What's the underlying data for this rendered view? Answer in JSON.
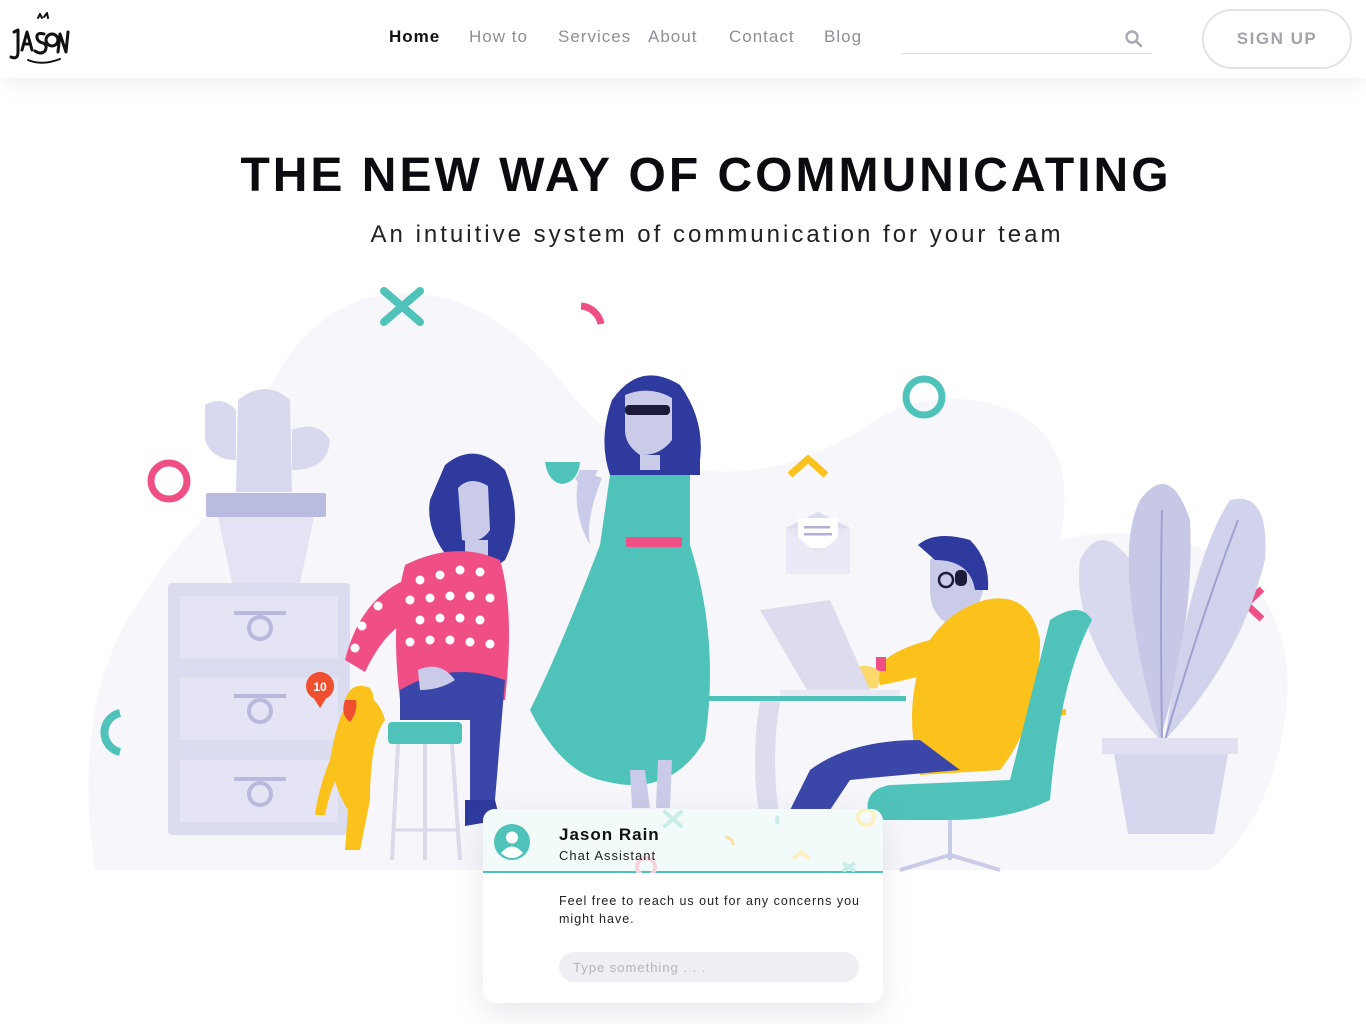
{
  "header": {
    "logo_text": "JASON",
    "nav": [
      {
        "label": "Home",
        "active": true
      },
      {
        "label": "How to",
        "active": false
      },
      {
        "label": "Services",
        "active": false
      },
      {
        "label": "About",
        "active": false
      },
      {
        "label": "Contact",
        "active": false
      },
      {
        "label": "Blog",
        "active": false
      }
    ],
    "search": {
      "placeholder": "",
      "icon": "search-icon"
    },
    "signup_label": "SIGN UP"
  },
  "hero": {
    "title": "THE NEW WAY OF COMMUNICATING",
    "subtitle": "An intuitive system of communication for your team"
  },
  "illustration": {
    "notification_count": "10"
  },
  "chat": {
    "name": "Jason Rain",
    "role": "Chat Assistant",
    "message": "Feel free to reach us out for any concerns you might have.",
    "input_placeholder": "Type something . . ."
  },
  "colors": {
    "teal": "#4fc3b9",
    "pink": "#ef4f84",
    "yellow": "#fbc21b",
    "navy": "#2e2f7f",
    "lavender": "#c9cbe8"
  }
}
